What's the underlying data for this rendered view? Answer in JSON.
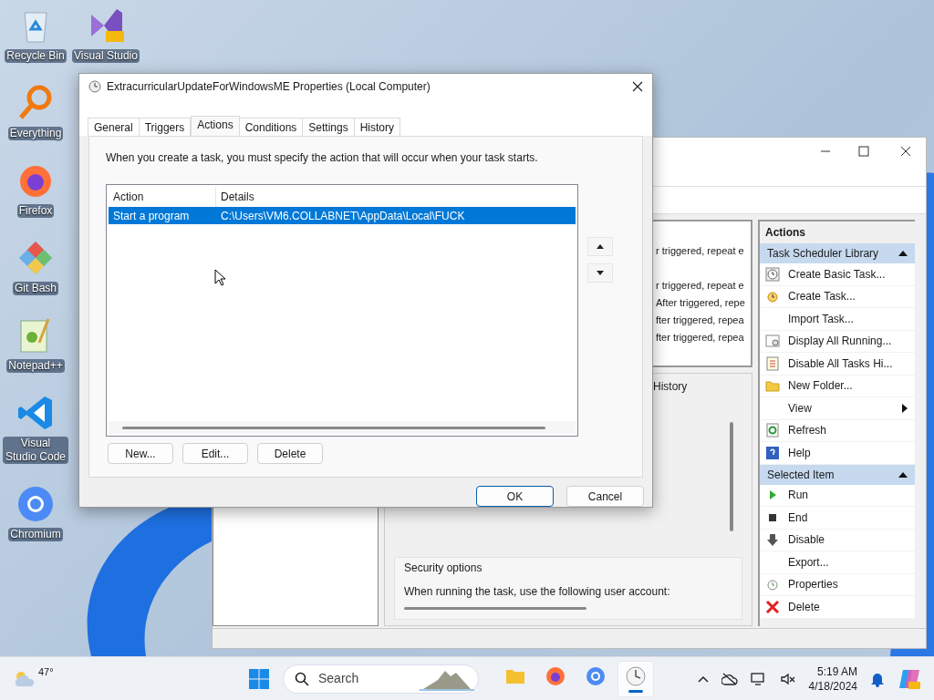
{
  "desktop_icons": [
    {
      "kind": "recycle",
      "label": "Recycle Bin"
    },
    {
      "kind": "vs",
      "label": "Visual Studio"
    },
    {
      "kind": "everything",
      "label": "Everything"
    },
    {
      "kind": "firefox",
      "label": "Firefox"
    },
    {
      "kind": "git",
      "label": "Git Bash"
    },
    {
      "kind": "notepad",
      "label": "Notepad++"
    },
    {
      "kind": "vscode",
      "label": "Visual Studio Code"
    },
    {
      "kind": "chromium",
      "label": "Chromium"
    }
  ],
  "task_scheduler": {
    "list_rows": [
      "r triggered, repeat e",
      "r triggered, repeat e",
      "After triggered, repe",
      "fter triggered, repea",
      "fter triggered, repea"
    ],
    "history_tab": "History",
    "security_options": {
      "title": "Security options",
      "text": "When running the task, use the following user account:"
    },
    "actions_pane": {
      "title": "Actions",
      "sections": [
        {
          "title": "Task Scheduler Library",
          "expanded": true,
          "items": [
            {
              "label": "Create Basic Task...",
              "submenu": false
            },
            {
              "label": "Create Task...",
              "submenu": false
            },
            {
              "label": "Import Task...",
              "submenu": false
            },
            {
              "label": "Display All Running...",
              "submenu": false
            },
            {
              "label": "Disable All Tasks Hi...",
              "submenu": false
            },
            {
              "label": "New Folder...",
              "submenu": false
            },
            {
              "label": "View",
              "submenu": true
            },
            {
              "label": "Refresh",
              "submenu": false
            },
            {
              "label": "Help",
              "submenu": false
            }
          ]
        },
        {
          "title": "Selected Item",
          "expanded": true,
          "items": [
            {
              "label": "Run",
              "submenu": false
            },
            {
              "label": "End",
              "submenu": false
            },
            {
              "label": "Disable",
              "submenu": false
            },
            {
              "label": "Export...",
              "submenu": false
            },
            {
              "label": "Properties",
              "submenu": false
            },
            {
              "label": "Delete",
              "submenu": false
            }
          ]
        }
      ]
    }
  },
  "dialog": {
    "title": "ExtracurricularUpdateForWindowsME Properties (Local Computer)",
    "tabs": [
      {
        "label": "General",
        "selected": false
      },
      {
        "label": "Triggers",
        "selected": false
      },
      {
        "label": "Actions",
        "selected": true
      },
      {
        "label": "Conditions",
        "selected": false
      },
      {
        "label": "Settings",
        "selected": false
      },
      {
        "label": "History",
        "selected": false
      }
    ],
    "description": "When you create a task, you must specify the action that will occur when your task starts.",
    "table": {
      "columns": [
        "Action",
        "Details"
      ],
      "rows": [
        {
          "cells": [
            "Start a program",
            "C:\\Users\\VM6.COLLABNET\\AppData\\Local\\FUCK"
          ],
          "selected": true
        }
      ]
    },
    "buttons": [
      "New...",
      "Edit...",
      "Delete"
    ],
    "footer_buttons": [
      {
        "label": "OK",
        "default": true
      },
      {
        "label": "Cancel",
        "default": false
      }
    ]
  },
  "taskbar": {
    "weather": "47°",
    "search": {
      "placeholder": "Search"
    },
    "apps": [
      {
        "kind": "explorer",
        "active": false
      },
      {
        "kind": "firefox",
        "active": false
      },
      {
        "kind": "chromium",
        "active": false
      },
      {
        "kind": "scheduler",
        "active": true
      }
    ],
    "time": "5:19 AM",
    "date": "4/18/2024"
  }
}
